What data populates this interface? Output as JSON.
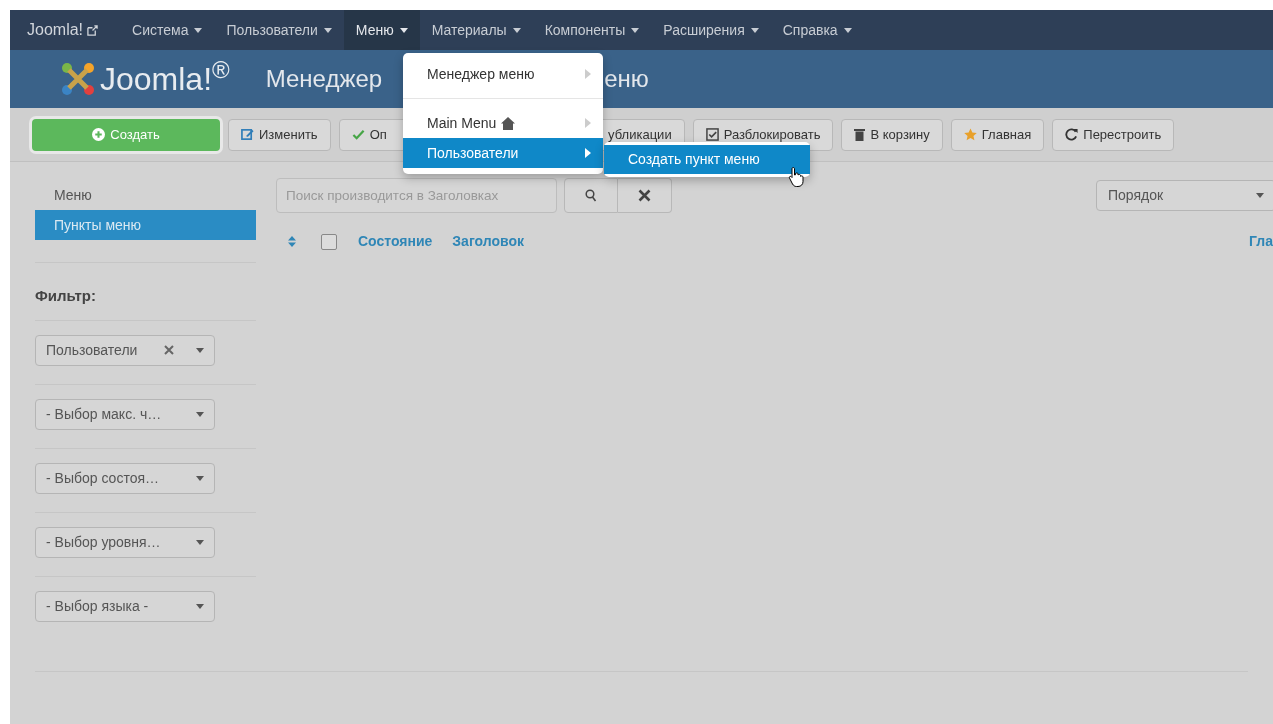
{
  "navbar": {
    "brand": "Joomla!",
    "items": [
      {
        "label": "Система",
        "selected": false
      },
      {
        "label": "Пользователи",
        "selected": false
      },
      {
        "label": "Меню",
        "selected": true
      },
      {
        "label": "Материалы",
        "selected": false
      },
      {
        "label": "Компоненты",
        "selected": false
      },
      {
        "label": "Расширения",
        "selected": false
      },
      {
        "label": "Справка",
        "selected": false
      }
    ]
  },
  "header": {
    "logo_text": "Joomla!$^{®}$",
    "title_parts": [
      "Менеджер",
      "еню"
    ]
  },
  "toolbar": {
    "buttons": [
      {
        "kind": "primary",
        "label": "Создать"
      },
      {
        "kind": "edit",
        "label": "Изменить"
      },
      {
        "kind": "publish",
        "label": "Оп"
      },
      {
        "kind": "hidden-start",
        "label": "убликации"
      },
      {
        "kind": "unlock",
        "label": "Разблокировать"
      },
      {
        "kind": "trash",
        "label": "В корзину"
      },
      {
        "kind": "star",
        "label": "Главная"
      },
      {
        "kind": "rebuild",
        "label": "Перестроить"
      }
    ]
  },
  "dropdown": {
    "items": [
      {
        "kind": "item",
        "label": "Менеджер меню",
        "selected": false
      },
      {
        "kind": "divider"
      },
      {
        "kind": "home",
        "label": "Main Menu",
        "selected": false
      },
      {
        "kind": "item",
        "label": "Пользователи",
        "selected": true
      }
    ]
  },
  "submenu": {
    "items": [
      {
        "label": "Создать пункт меню",
        "selected": true
      }
    ]
  },
  "sidebar": {
    "items": [
      {
        "label": "Меню",
        "selected": false
      },
      {
        "label": "Пункты меню",
        "selected": true
      }
    ],
    "filter_title": "Фильтр:",
    "filters": [
      {
        "value": "Пользователи",
        "clearable": true
      },
      {
        "value": "- Выбор макс. ч…",
        "clearable": false
      },
      {
        "value": "- Выбор состоя…",
        "clearable": false
      },
      {
        "value": "- Выбор уровня…",
        "clearable": false
      },
      {
        "value": "- Выбор языка -",
        "clearable": false
      }
    ]
  },
  "search": {
    "placeholder": "Поиск производится в Заголовках"
  },
  "ordering": {
    "value": "Порядок"
  },
  "table": {
    "select_all_checked": false,
    "columns": [
      "Состояние",
      "Заголовок",
      "Гла"
    ]
  }
}
